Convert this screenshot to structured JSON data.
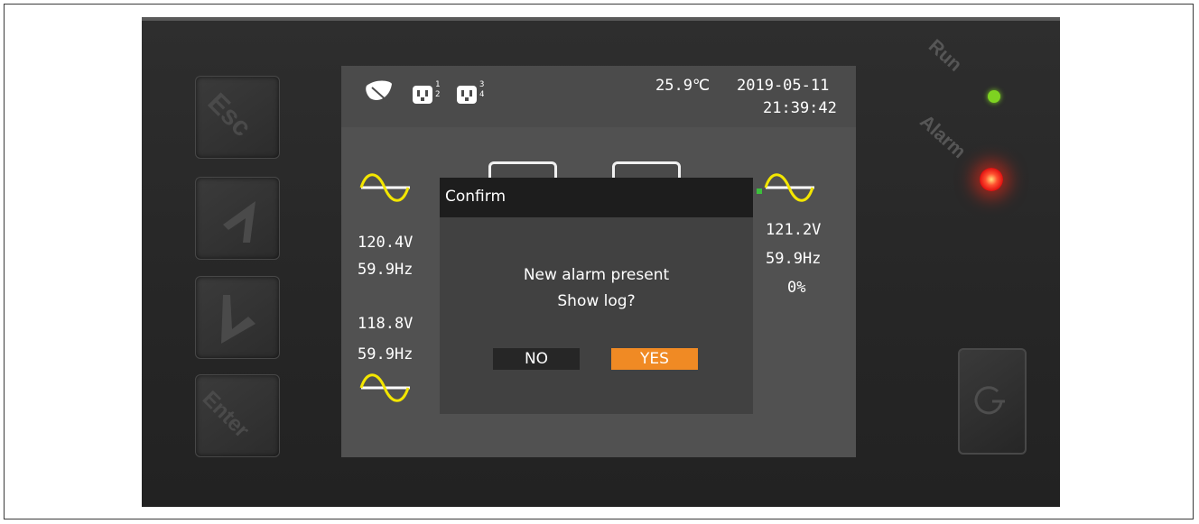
{
  "keys": {
    "esc_label": "Esc",
    "up_label": "up",
    "down_label": "down",
    "enter_label": "Enter"
  },
  "status_bar": {
    "temperature": "25.9℃",
    "date": "2019-05-11",
    "time": "21:39:42",
    "outlet_group_a": [
      "1",
      "2"
    ],
    "outlet_group_b": [
      "3",
      "4"
    ]
  },
  "input_left": {
    "voltage_1": "120.4V",
    "frequency_1": "59.9Hz",
    "voltage_2": "118.8V",
    "frequency_2": "59.9Hz"
  },
  "output_right": {
    "voltage": "121.2V",
    "frequency": "59.9Hz",
    "load": "0%"
  },
  "dialog": {
    "title": "Confirm",
    "message_line1": "New alarm present",
    "message_line2": "Show log?",
    "no_label": "NO",
    "yes_label": "YES"
  },
  "leds": {
    "run_label": "Run",
    "alarm_label": "Alarm",
    "run_color": "#7ed321",
    "alarm_color": "#ff2a1a"
  },
  "colors": {
    "wave": "#f3e600",
    "yes_button": "#f08a24",
    "no_button": "#262626"
  }
}
